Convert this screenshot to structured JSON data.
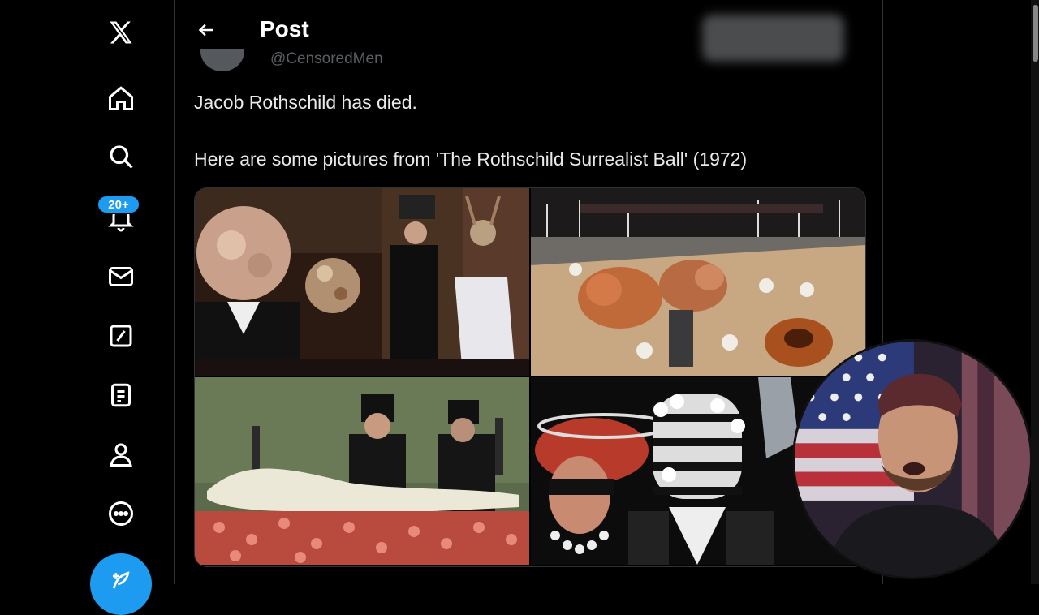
{
  "app": {
    "logo": "x-logo-icon"
  },
  "sidebar": {
    "items": [
      {
        "name": "home",
        "icon": "home-icon"
      },
      {
        "name": "explore",
        "icon": "search-icon"
      },
      {
        "name": "notifications",
        "icon": "bell-icon",
        "badge": "20+"
      },
      {
        "name": "messages",
        "icon": "mail-icon"
      },
      {
        "name": "grok",
        "icon": "slash-square-icon"
      },
      {
        "name": "lists",
        "icon": "list-icon"
      },
      {
        "name": "profile",
        "icon": "person-icon"
      },
      {
        "name": "more",
        "icon": "more-circle-icon"
      }
    ],
    "compose_icon": "feather-plus-icon"
  },
  "header": {
    "title": "Post",
    "back_icon": "arrow-left-icon"
  },
  "post": {
    "handle": "@CensoredMen",
    "text_line1": "Jacob Rothschild has died.",
    "text_line2": "Here are some pictures from 'The Rothschild Surrealist Ball' (1972)",
    "media_count": 4
  },
  "colors": {
    "accent": "#1d9bf0",
    "background": "#000000",
    "text": "#e7e9ea",
    "muted": "#71767b",
    "border": "#2f3336"
  }
}
